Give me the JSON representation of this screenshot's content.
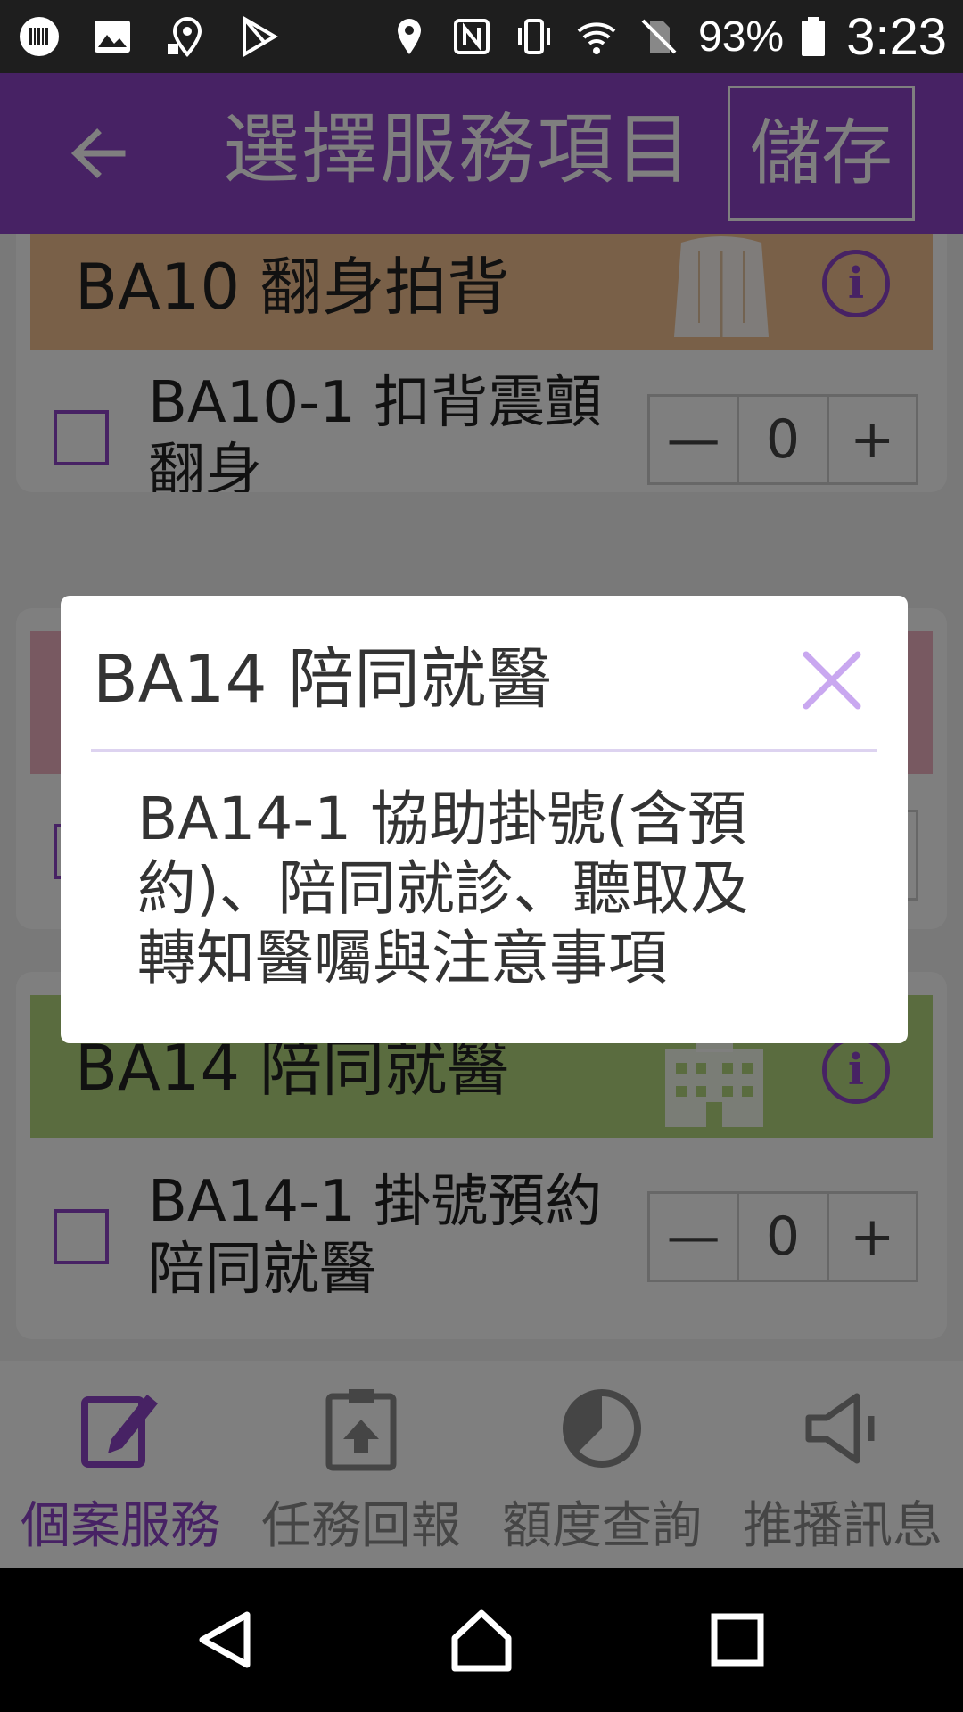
{
  "status_bar": {
    "battery_text": "93%",
    "time": "3:23",
    "icons": [
      "barcode-app-icon",
      "image-icon",
      "location-app-icon",
      "play-store-icon",
      "location-pin-icon",
      "nfc-icon",
      "vibrate-icon",
      "wifi-icon",
      "no-sim-icon",
      "battery-icon"
    ]
  },
  "app_bar": {
    "title": "選擇服務項目",
    "save_label": "儲存",
    "background": "#8e44c8"
  },
  "cards": [
    {
      "title": "BA10 翻身拍背",
      "header_color": "#f2c190",
      "illustration": "shirt-back-icon",
      "items": [
        {
          "label": "BA10-1 扣背震顫翻身",
          "quantity": "0",
          "checked": false
        }
      ]
    },
    {
      "title": "",
      "header_color": "#f0b3c2",
      "items": [
        {
          "label": "",
          "quantity": "",
          "checked": false
        }
      ]
    },
    {
      "title": "BA14 陪同就醫",
      "header_color": "#b5d97f",
      "illustration": "hospital-building-icon",
      "items": [
        {
          "label": "BA14-1 掛號預約陪同就醫",
          "quantity": "0",
          "checked": false
        }
      ]
    }
  ],
  "stepper": {
    "minus": "—",
    "plus": "+"
  },
  "bottom_nav": [
    {
      "label": "個案服務",
      "icon": "edit-note-icon",
      "active": true
    },
    {
      "label": "任務回報",
      "icon": "clipboard-upload-icon",
      "active": false
    },
    {
      "label": "額度查詢",
      "icon": "pie-chart-icon",
      "active": false
    },
    {
      "label": "推播訊息",
      "icon": "megaphone-icon",
      "active": false
    }
  ],
  "dialog": {
    "title": "BA14 陪同就醫",
    "body": "BA14-1 協助掛號(含預約)、陪同就診、聽取及轉知醫囑與注意事項"
  },
  "colors": {
    "accent": "#8e44c8",
    "close_icon": "#c9a8f0"
  }
}
